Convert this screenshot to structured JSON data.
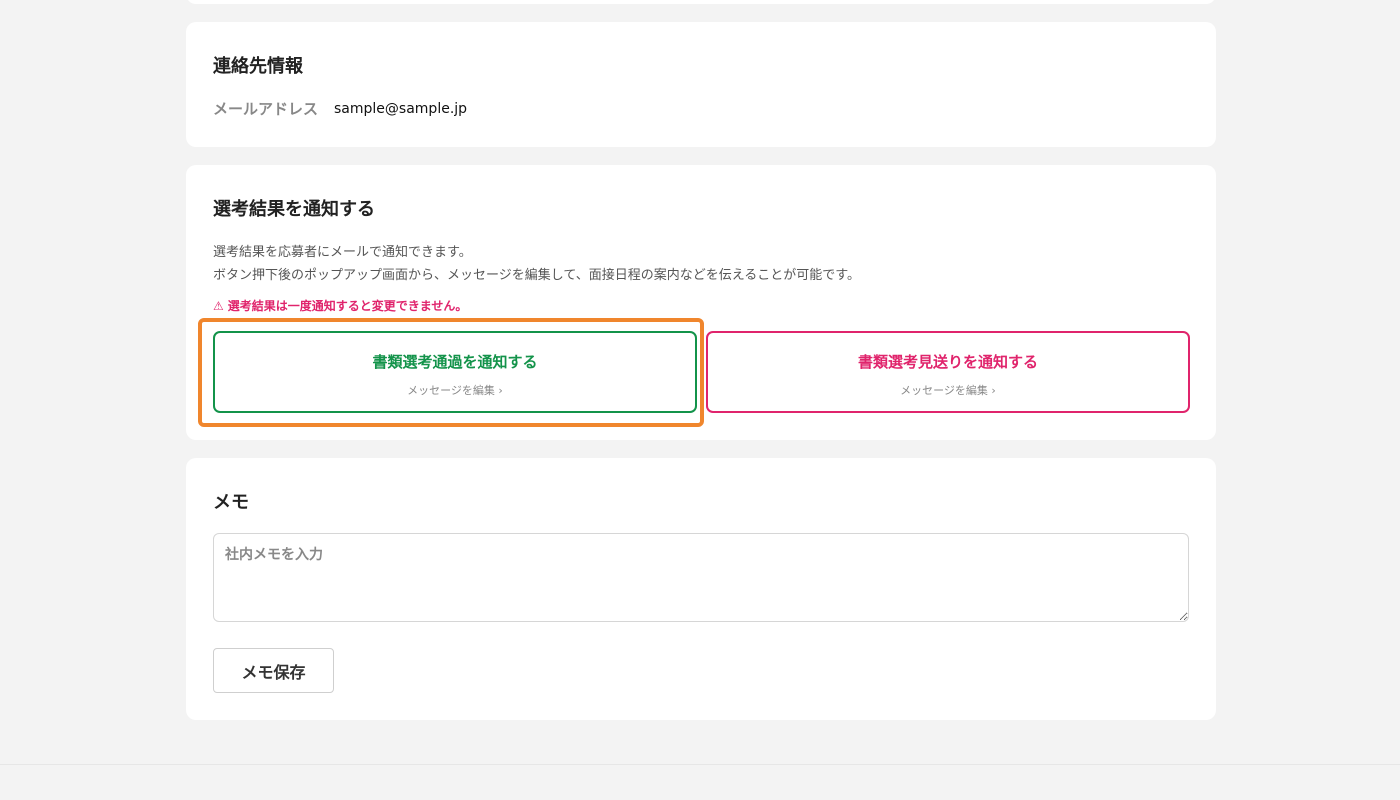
{
  "contact": {
    "title": "連絡先情報",
    "email_label": "メールアドレス",
    "email_value": "sample@sample.jp"
  },
  "result": {
    "title": "選考結果を通知する",
    "desc_line1": "選考結果を応募者にメールで通知できます。",
    "desc_line2": "ボタン押下後のポップアップ画面から、メッセージを編集して、面接日程の案内などを伝えることが可能です。",
    "warning": "選考結果は一度通知すると変更できません。",
    "pass_button": {
      "label": "書類選考通過を通知する",
      "sub": "メッセージを編集 ›"
    },
    "reject_button": {
      "label": "書類選考見送りを通知する",
      "sub": "メッセージを編集 ›"
    },
    "colors": {
      "pass": "#13934a",
      "reject": "#e0246c",
      "highlight": "#f0862d"
    }
  },
  "memo": {
    "title": "メモ",
    "placeholder": "社内メモを入力",
    "save_label": "メモ保存"
  }
}
